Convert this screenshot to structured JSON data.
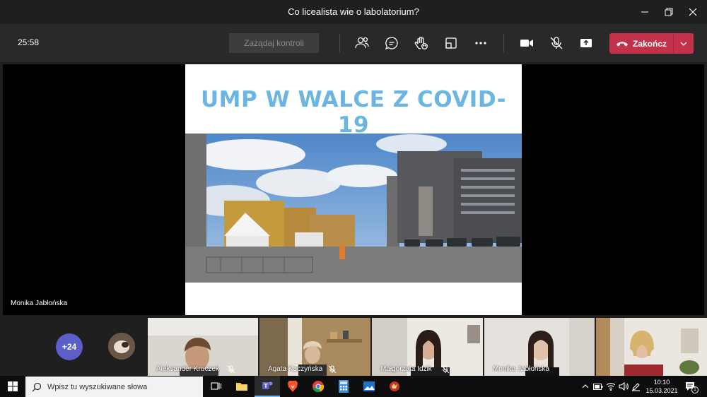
{
  "window": {
    "title": "Co licealista wie o labolatorium?"
  },
  "toolbar": {
    "timer": "25:58",
    "request_control_label": "Zażądaj kontroli",
    "end_label": "Zakończ"
  },
  "stage": {
    "presenter_name": "Monika Jabłońska",
    "slide_title": "UMP W WALCE Z COVID-19"
  },
  "gallery": {
    "more_count": "+24",
    "participants": [
      {
        "name": "Aleksander Kruczek"
      },
      {
        "name": "Agata Kaczyńska"
      },
      {
        "name": "Małgorzata Idzik"
      },
      {
        "name": "Monika Jabłońska"
      },
      {
        "name": ""
      }
    ]
  },
  "taskbar": {
    "search_placeholder": "Wpisz tu wyszukiwane słowa",
    "time": "10:10",
    "date": "15.03.2021",
    "notification_count": "1"
  },
  "colors": {
    "end_button": "#c4314b",
    "accent": "#5b5fc7",
    "slide_title": "#6bb5e3"
  }
}
